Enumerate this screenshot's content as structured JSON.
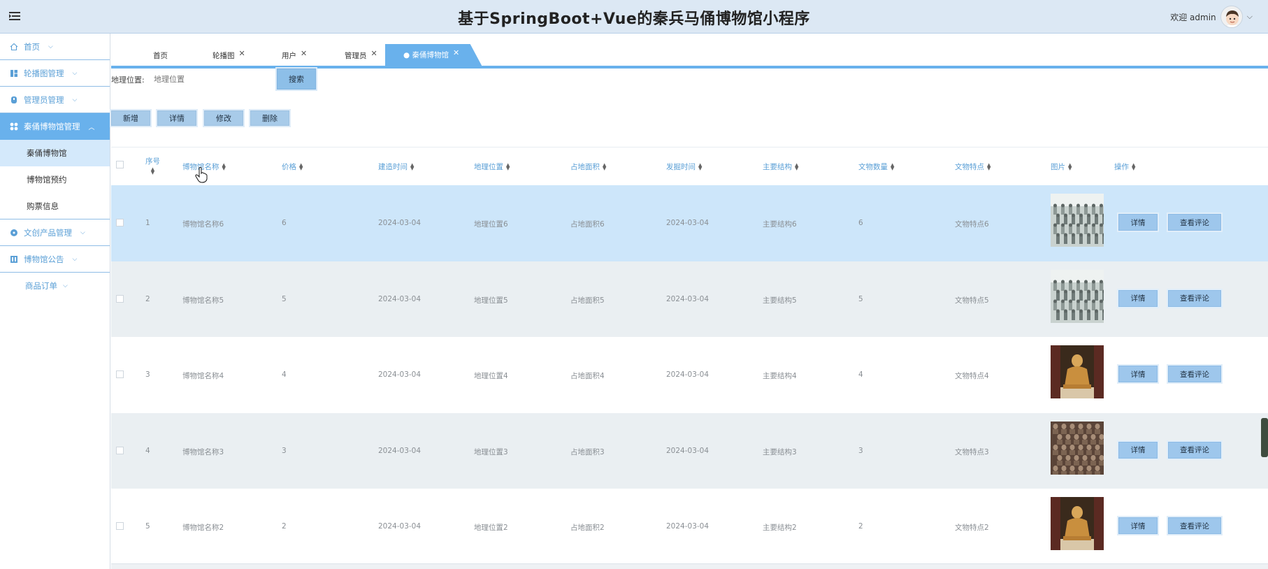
{
  "header": {
    "title": "基于SpringBoot+Vue的秦兵马俑博物馆小程序",
    "welcome": "欢迎 admin"
  },
  "sidebar": {
    "items": [
      {
        "label": "首页",
        "icon": "home-icon"
      },
      {
        "label": "轮播图管理",
        "icon": "carousel-icon"
      },
      {
        "label": "管理员管理",
        "icon": "admin-icon"
      },
      {
        "label": "秦俑博物馆管理",
        "icon": "museum-grid-icon",
        "active": true,
        "children": [
          "秦俑博物馆",
          "博物馆预约",
          "购票信息"
        ]
      },
      {
        "label": "文创产品管理",
        "icon": "product-icon"
      },
      {
        "label": "博物馆公告",
        "icon": "notice-icon"
      },
      {
        "label": "商品订单",
        "icon": ""
      }
    ]
  },
  "tabs": [
    {
      "label": "首页",
      "closable": false
    },
    {
      "label": "轮播图",
      "closable": true
    },
    {
      "label": "用户",
      "closable": true
    },
    {
      "label": "管理员",
      "closable": true
    },
    {
      "label": "● 秦俑博物馆",
      "closable": true,
      "active": true
    }
  ],
  "search": {
    "label": "地理位置:",
    "placeholder": "地理位置",
    "button": "搜索"
  },
  "actions": {
    "add": "新增",
    "detail": "详情",
    "edit": "修改",
    "delete": "删除"
  },
  "table": {
    "columns": [
      "序号",
      "博物馆名称",
      "价格",
      "建造时间",
      "地理位置",
      "占地面积",
      "发掘时间",
      "主要结构",
      "文物数量",
      "文物特点",
      "图片",
      "操作"
    ],
    "rows": [
      {
        "index": "1",
        "name": "博物馆名称6",
        "price": "6",
        "built": "2024-03-04",
        "location": "地理位置6",
        "area": "占地面积6",
        "excavated": "2024-03-04",
        "structure": "主要结构6",
        "count": "6",
        "feature": "文物特点6",
        "image": "terracotta-army"
      },
      {
        "index": "2",
        "name": "博物馆名称5",
        "price": "5",
        "built": "2024-03-04",
        "location": "地理位置5",
        "area": "占地面积5",
        "excavated": "2024-03-04",
        "structure": "主要结构5",
        "count": "5",
        "feature": "文物特点5",
        "image": "terracotta-army"
      },
      {
        "index": "3",
        "name": "博物馆名称4",
        "price": "4",
        "built": "2024-03-04",
        "location": "地理位置4",
        "area": "占地面积4",
        "excavated": "2024-03-04",
        "structure": "主要结构4",
        "count": "4",
        "feature": "文物特点4",
        "image": "kneeling-archer"
      },
      {
        "index": "4",
        "name": "博物馆名称3",
        "price": "3",
        "built": "2024-03-04",
        "location": "地理位置3",
        "area": "占地面积3",
        "excavated": "2024-03-04",
        "structure": "主要结构3",
        "count": "3",
        "feature": "文物特点3",
        "image": "warrior-ranks"
      },
      {
        "index": "5",
        "name": "博物馆名称2",
        "price": "2",
        "built": "2024-03-04",
        "location": "地理位置2",
        "area": "占地面积2",
        "excavated": "2024-03-04",
        "structure": "主要结构2",
        "count": "2",
        "feature": "文物特点2",
        "image": "kneeling-archer"
      }
    ],
    "row_detail_label": "详情",
    "row_review_label": "查看评论"
  },
  "colors": {
    "accent": "#69b1ec",
    "header_bg": "#dce8f4",
    "link": "#5a9fd6",
    "selected_row": "#cde6fa",
    "stripe_row": "#eaeff2"
  }
}
